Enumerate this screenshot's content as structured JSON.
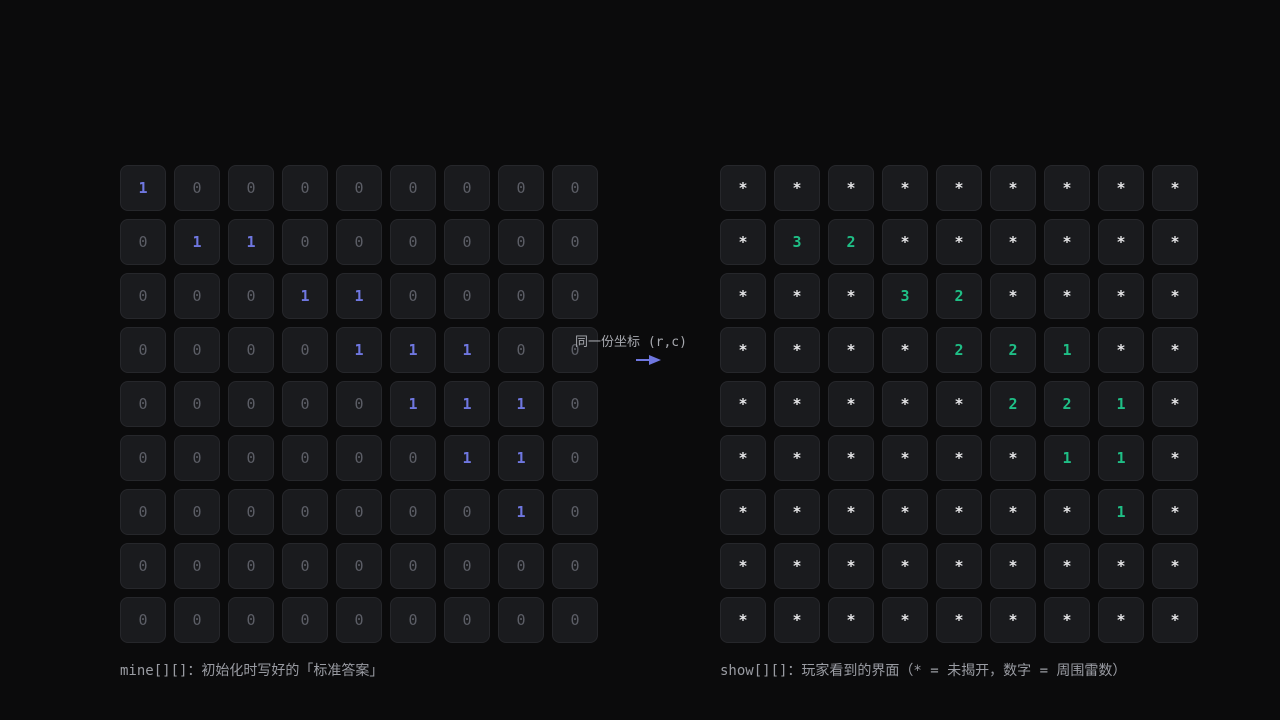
{
  "mine_grid": {
    "caption": "mine[][]：初始化时写好的「标准答案」",
    "rows": [
      [
        "1",
        "0",
        "0",
        "0",
        "0",
        "0",
        "0",
        "0",
        "0"
      ],
      [
        "0",
        "1",
        "1",
        "0",
        "0",
        "0",
        "0",
        "0",
        "0"
      ],
      [
        "0",
        "0",
        "0",
        "1",
        "1",
        "0",
        "0",
        "0",
        "0"
      ],
      [
        "0",
        "0",
        "0",
        "0",
        "1",
        "1",
        "1",
        "0",
        "0"
      ],
      [
        "0",
        "0",
        "0",
        "0",
        "0",
        "1",
        "1",
        "1",
        "0"
      ],
      [
        "0",
        "0",
        "0",
        "0",
        "0",
        "0",
        "1",
        "1",
        "0"
      ],
      [
        "0",
        "0",
        "0",
        "0",
        "0",
        "0",
        "0",
        "1",
        "0"
      ],
      [
        "0",
        "0",
        "0",
        "0",
        "0",
        "0",
        "0",
        "0",
        "0"
      ],
      [
        "0",
        "0",
        "0",
        "0",
        "0",
        "0",
        "0",
        "0",
        "0"
      ]
    ]
  },
  "show_grid": {
    "caption": "show[][]：玩家看到的界面（* = 未揭开，数字 = 周围雷数）",
    "rows": [
      [
        "*",
        "*",
        "*",
        "*",
        "*",
        "*",
        "*",
        "*",
        "*"
      ],
      [
        "*",
        "3",
        "2",
        "*",
        "*",
        "*",
        "*",
        "*",
        "*"
      ],
      [
        "*",
        "*",
        "*",
        "3",
        "2",
        "*",
        "*",
        "*",
        "*"
      ],
      [
        "*",
        "*",
        "*",
        "*",
        "2",
        "2",
        "1",
        "*",
        "*"
      ],
      [
        "*",
        "*",
        "*",
        "*",
        "*",
        "2",
        "2",
        "1",
        "*"
      ],
      [
        "*",
        "*",
        "*",
        "*",
        "*",
        "*",
        "1",
        "1",
        "*"
      ],
      [
        "*",
        "*",
        "*",
        "*",
        "*",
        "*",
        "*",
        "1",
        "*"
      ],
      [
        "*",
        "*",
        "*",
        "*",
        "*",
        "*",
        "*",
        "*",
        "*"
      ],
      [
        "*",
        "*",
        "*",
        "*",
        "*",
        "*",
        "*",
        "*",
        "*"
      ]
    ]
  },
  "connector": {
    "label": "同一份坐标 (r,c)",
    "icon": "right-arrow-icon"
  },
  "colors": {
    "background": "#0b0b0c",
    "cell": "#1a1b1e",
    "zero": "#5c5e66",
    "mine": "#6f77e0",
    "hidden": "#e8e8ea",
    "revealed": "#1fbf86"
  }
}
